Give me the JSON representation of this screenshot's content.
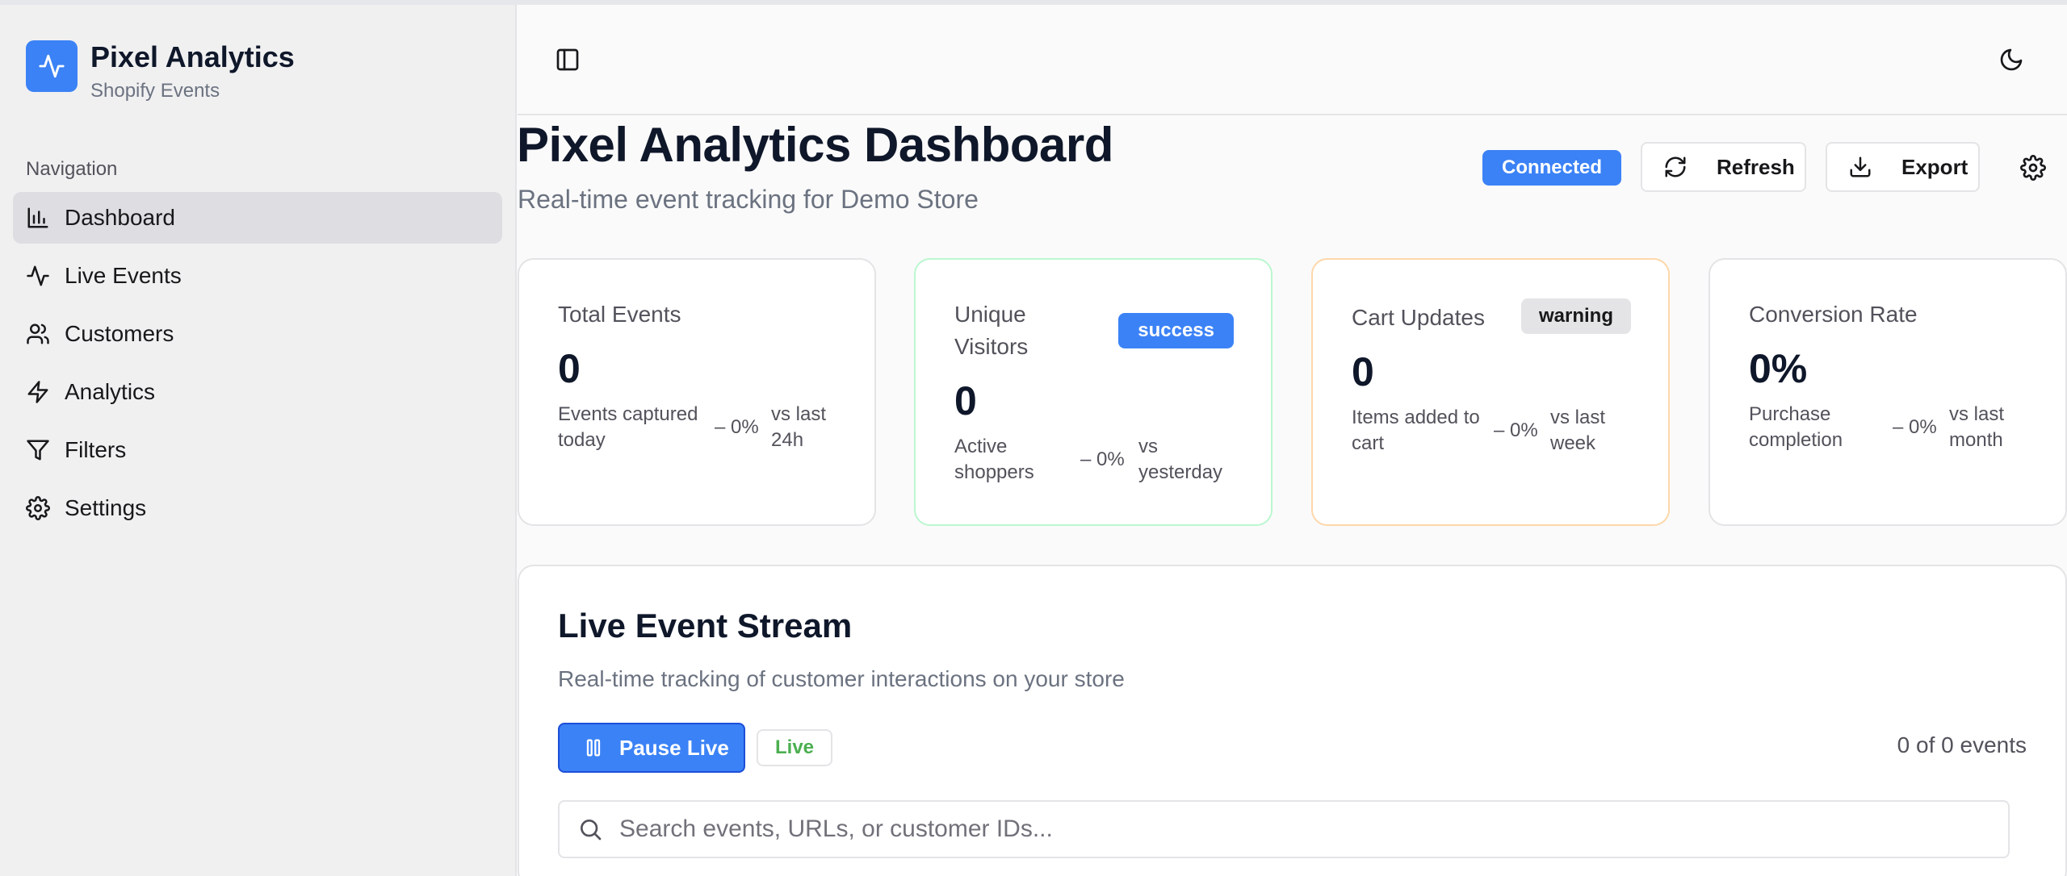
{
  "brand": {
    "title": "Pixel Analytics",
    "subtitle": "Shopify Events"
  },
  "sidebar": {
    "section_label": "Navigation",
    "items": [
      {
        "label": "Dashboard",
        "icon": "bar-chart-icon",
        "active": true
      },
      {
        "label": "Live Events",
        "icon": "activity-icon",
        "active": false
      },
      {
        "label": "Customers",
        "icon": "users-icon",
        "active": false
      },
      {
        "label": "Analytics",
        "icon": "zap-icon",
        "active": false
      },
      {
        "label": "Filters",
        "icon": "filter-icon",
        "active": false
      },
      {
        "label": "Settings",
        "icon": "gear-icon",
        "active": false
      }
    ]
  },
  "header": {
    "title": "Pixel Analytics Dashboard",
    "subtitle": "Real-time event tracking for Demo Store",
    "status": "Connected",
    "refresh_label": "Refresh",
    "export_label": "Export"
  },
  "stats": [
    {
      "title": "Total Events",
      "value": "0",
      "description": "Events captured today",
      "change": "0%",
      "comparison": "vs last 24h",
      "badge": ""
    },
    {
      "title": "Unique Visitors",
      "value": "0",
      "description": "Active shoppers",
      "change": "0%",
      "comparison": "vs yesterday",
      "badge": "success"
    },
    {
      "title": "Cart Updates",
      "value": "0",
      "description": "Items added to cart",
      "change": "0%",
      "comparison": "vs last week",
      "badge": "warning"
    },
    {
      "title": "Conversion Rate",
      "value": "0%",
      "description": "Purchase completion",
      "change": "0%",
      "comparison": "vs last month",
      "badge": ""
    }
  ],
  "stream": {
    "title": "Live Event Stream",
    "subtitle": "Real-time tracking of customer interactions on your store",
    "pause_label": "Pause Live",
    "live_label": "Live",
    "count_text": "0 of 0 events",
    "search_placeholder": "Search events, URLs, or customer IDs..."
  },
  "colors": {
    "accent": "#3b82f6",
    "live_green": "#4caf50",
    "sidebar_bg": "#f0f0f1"
  }
}
